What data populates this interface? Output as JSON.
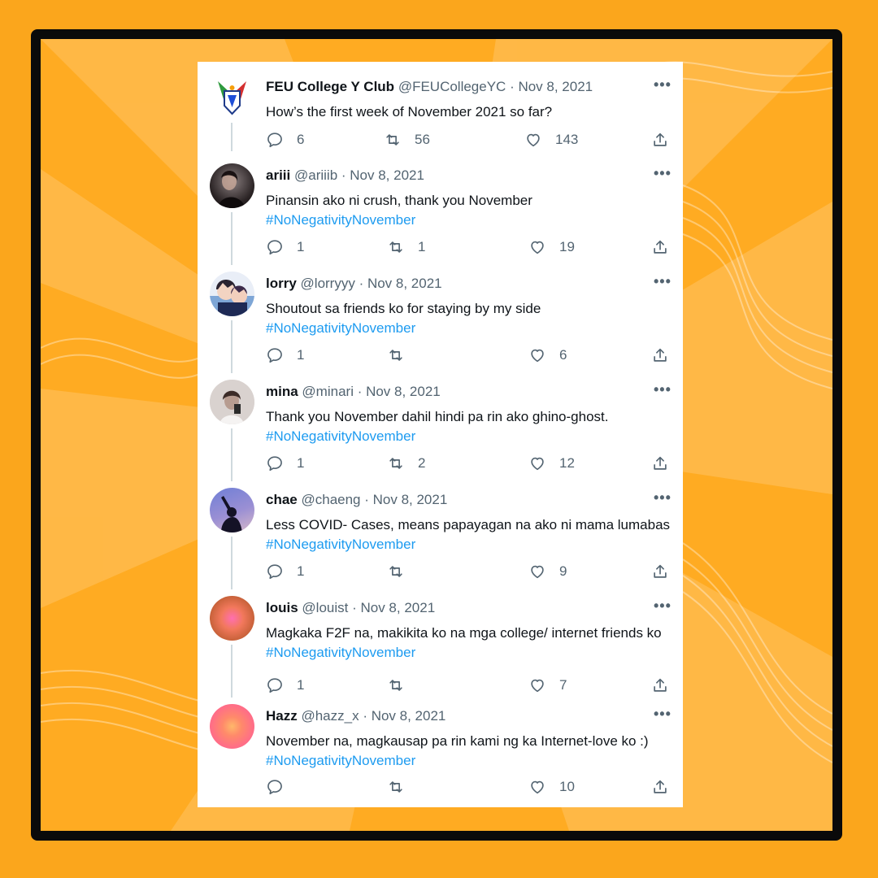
{
  "tweets": [
    {
      "name": "FEU College Y Club",
      "handle": "@FEUCollegeYC",
      "date": "Nov 8, 2021",
      "text": "How’s the first week of November 2021 so far?",
      "hashtag": "",
      "replies": "6",
      "retweets": "56",
      "likes": "143"
    },
    {
      "name": "ariii",
      "handle": "@ariiib",
      "date": "Nov 8, 2021",
      "text": "Pinansin ako ni crush, thank you November",
      "hashtag": "#NoNegativityNovember",
      "replies": "1",
      "retweets": "1",
      "likes": "19"
    },
    {
      "name": "lorry",
      "handle": "@lorryyy",
      "date": "Nov 8, 2021",
      "text": "Shoutout sa friends ko for staying by my side",
      "hashtag": "#NoNegativityNovember",
      "replies": "1",
      "retweets": "",
      "likes": "6"
    },
    {
      "name": "mina",
      "handle": "@minari",
      "date": "Nov 8, 2021",
      "text": "Thank you November dahil hindi pa rin ako ghino-ghost.",
      "hashtag": "#NoNegativityNovember",
      "replies": "1",
      "retweets": "2",
      "likes": "12"
    },
    {
      "name": "chae",
      "handle": "@chaeng",
      "date": "Nov 8, 2021",
      "text": "Less COVID- Cases, means papayagan na ako ni mama lumabas ",
      "hashtag": "#NoNegativityNovember",
      "replies": "1",
      "retweets": "",
      "likes": "9"
    },
    {
      "name": "louis",
      "handle": "@louist",
      "date": "Nov 8, 2021",
      "text": "Magkaka F2F na, makikita ko na mga college/ internet friends ko ",
      "hashtag": "#NoNegativityNovember",
      "replies": "1",
      "retweets": "",
      "likes": "7"
    },
    {
      "name": "Hazz",
      "handle": "@hazz_x",
      "date": "Nov 8, 2021",
      "text": "November na, magkausap pa rin kami ng ka Internet-love ko :)",
      "hashtag": "#NoNegativityNovember",
      "replies": "",
      "retweets": "",
      "likes": "10"
    }
  ],
  "ui": {
    "separator": " · ",
    "more_glyph": "•••",
    "icons": [
      "reply-icon",
      "retweet-icon",
      "like-icon",
      "share-icon",
      "more-icon"
    ]
  },
  "colors": {
    "background": "#fba61c",
    "frame": "#0a0a0a",
    "card": "#ffffff",
    "hashtag": "#1d9bf0",
    "muted": "#536471",
    "thread_line": "#cfd9de"
  }
}
